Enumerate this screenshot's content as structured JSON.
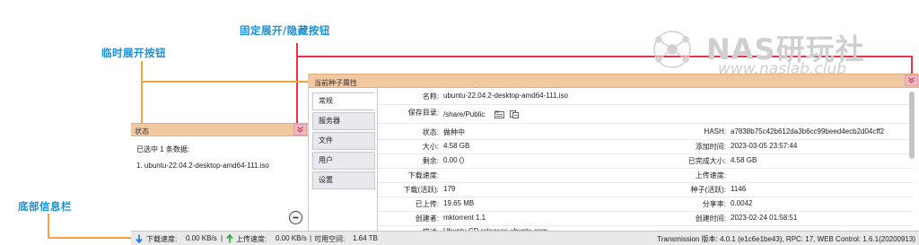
{
  "annotations": {
    "pin_toggle": "固定展开/隐藏按钮",
    "temp_expand": "临时展开按钮",
    "bottom_bar": "底部信息栏"
  },
  "watermark": {
    "brand": "NAS研玩社",
    "url": "www.naslab.club"
  },
  "status_panel": {
    "title": "状态",
    "selected_count": "已选中 1 条数据:",
    "selected_item": "1. ubuntu-22.04.2-desktop-amd64-111.iso",
    "toggle_icon": "chevrons-down-icon",
    "circle_icon": "collapse-circle-icon"
  },
  "torrent_panel": {
    "title": "当前种子属性",
    "tabs": [
      {
        "label": "常规",
        "active": true
      },
      {
        "label": "服务器",
        "active": false
      },
      {
        "label": "文件",
        "active": false
      },
      {
        "label": "用户",
        "active": false
      },
      {
        "label": "设置",
        "active": false
      }
    ],
    "general": {
      "name_label": "名称:",
      "name_value": "ubuntu-22.04.2-desktop-amd64-111.iso",
      "save_dir_label": "保存目录:",
      "save_dir_value": "/share/Public",
      "status_label": "状态:",
      "status_value": "做种中",
      "size_label": "大小:",
      "size_value": "4.58 GB",
      "remaining_label": "剩余:",
      "remaining_value": "0.00 ()",
      "download_speed_label": "下载速度:",
      "download_speed_value": "",
      "downloaded_label": "下载(活跃):",
      "downloaded_value": "179",
      "uploaded_label": "已上传:",
      "uploaded_value": "19.65 MB",
      "creator_label": "创建者:",
      "creator_value": "mktorrent 1.1",
      "desc_label": "描述:",
      "desc_value": "Ubuntu CD releases.ubuntu.com",
      "hash_label": "HASH:",
      "hash_value": "a7838b75c42b612da3b6cc99beed4ecb2d04cff2",
      "added_label": "添加时间:",
      "added_value": "2023-03-05 23:57:44",
      "completed_label": "已完成大小:",
      "completed_value": "4.58 GB",
      "upload_speed_label": "上传速度:",
      "upload_speed_value": "",
      "seeds_label": "种子(活跃):",
      "seeds_value": "1146",
      "ratio_label": "分享率:",
      "ratio_value": "0.0042",
      "created_label": "创建时间:",
      "created_value": "2023-02-24 01:58:51"
    }
  },
  "bottom_bar": {
    "download_label": "下载速度:",
    "download_value": "0.00 KB/s",
    "upload_label": "上传速度:",
    "upload_value": "0.00 KB/s",
    "free_space_label": "可用空间:",
    "free_space_value": "1.64 TB",
    "separator": "|",
    "version": "Transmission 版本: 4.0.1 (e1c6e1be43), RPC: 17, WEB Control: 1.6.1(20200913)"
  },
  "colors": {
    "annotation_text": "#1a8fd6",
    "annotation_orange": "#f4a340",
    "annotation_red": "#e8334a",
    "panel_header": "#f0c9a0",
    "toggle_button": "#f3b6c2"
  }
}
